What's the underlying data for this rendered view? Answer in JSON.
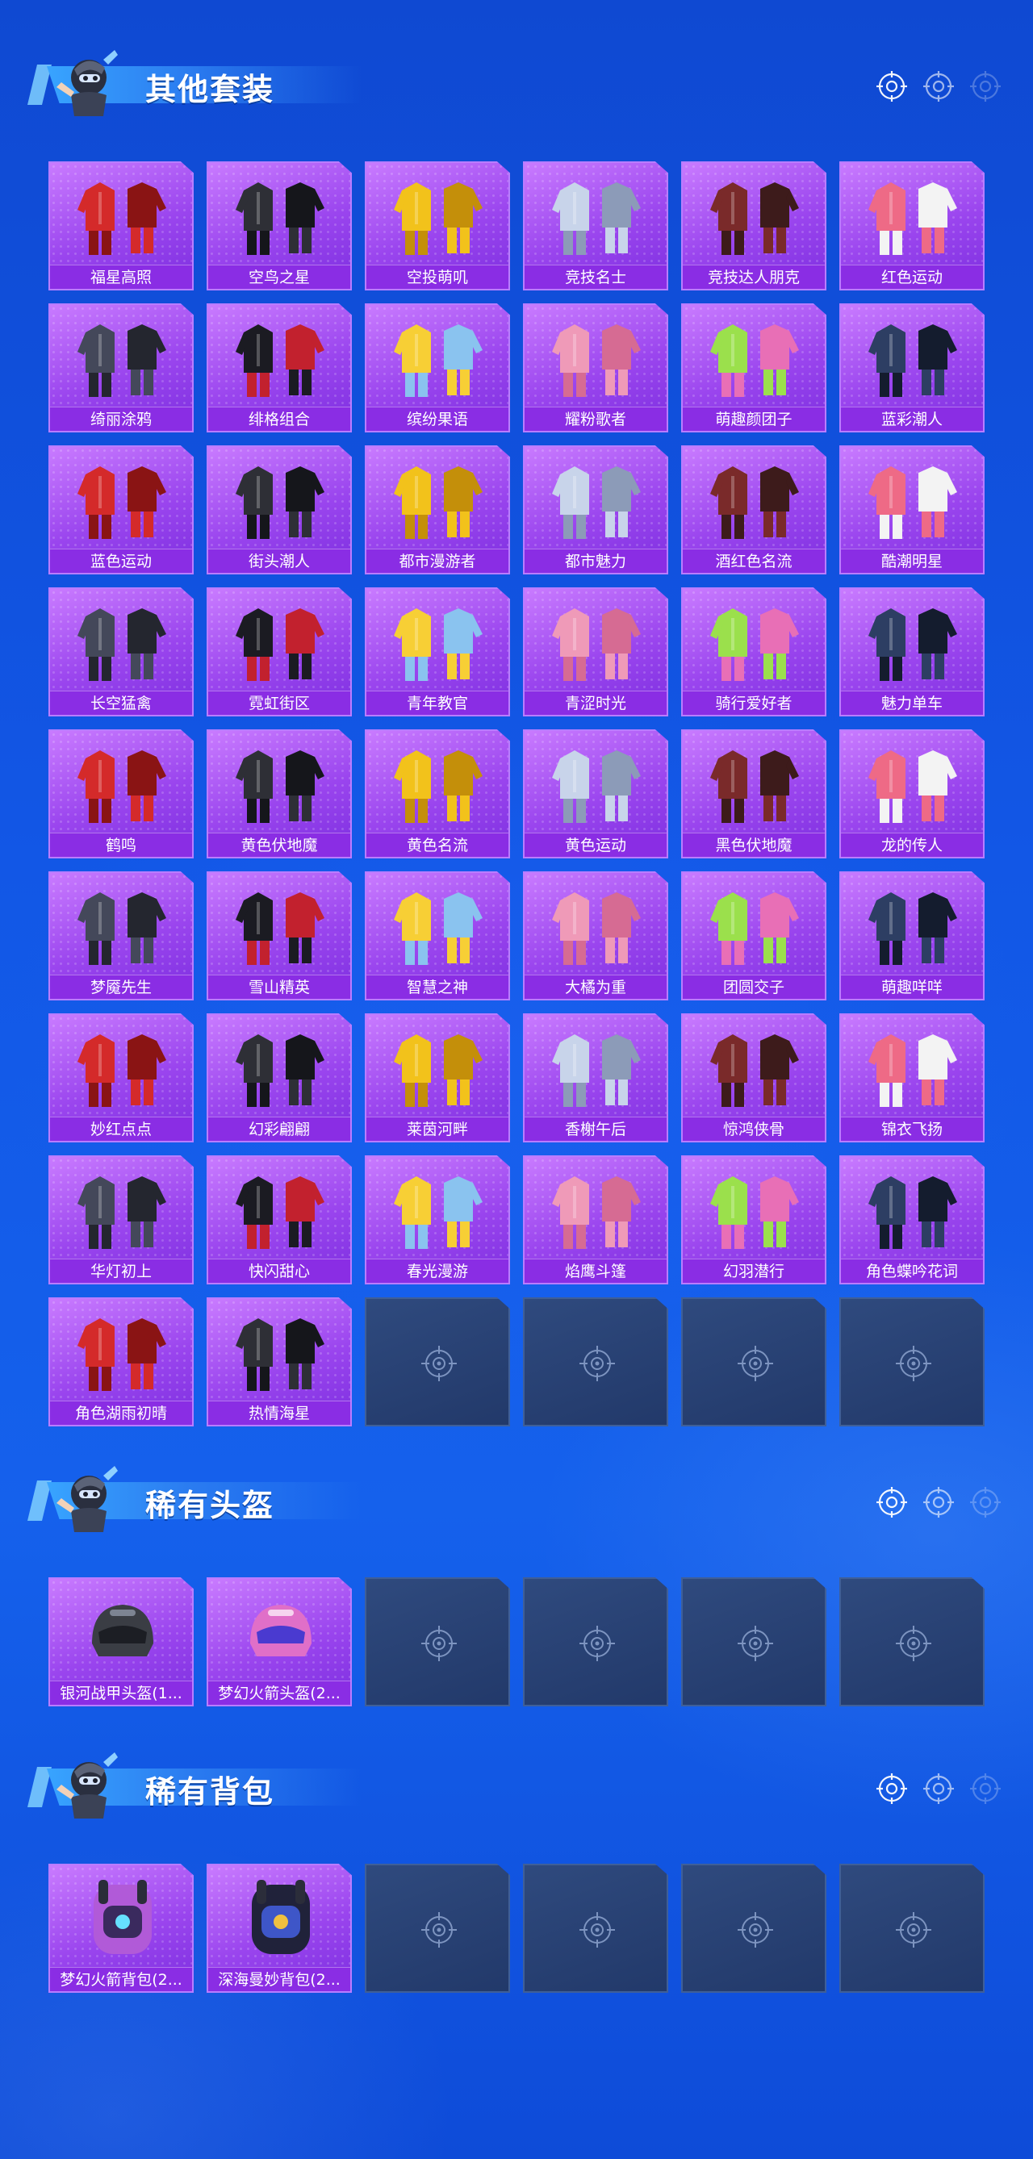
{
  "sections": [
    {
      "title": "其他套装",
      "items": [
        "福星高照",
        "空鸟之星",
        "空投萌叽",
        "竞技名士",
        "竞技达人朋克",
        "红色运动",
        "绮丽涂鸦",
        "绯格组合",
        "缤纷果语",
        "耀粉歌者",
        "萌趣颜团子",
        "蓝彩潮人",
        "蓝色运动",
        "街头潮人",
        "都市漫游者",
        "都市魅力",
        "酒红色名流",
        "酷潮明星",
        "长空猛禽",
        "霓虹街区",
        "青年教官",
        "青涩时光",
        "骑行爱好者",
        "魅力单车",
        "鹤鸣",
        "黄色伏地魔",
        "黄色名流",
        "黄色运动",
        "黑色伏地魔",
        "龙的传人",
        "梦魇先生",
        "雪山精英",
        "智慧之神",
        "大橘为重",
        "团圆交子",
        "萌趣咩咩",
        "妙红点点",
        "幻彩翩翩",
        "莱茵河畔",
        "香榭午后",
        "惊鸿侠骨",
        "锦衣飞扬",
        "华灯初上",
        "快闪甜心",
        "春光漫游",
        "焰鹰斗篷",
        "幻羽潜行",
        "角色蝶吟花词",
        "角色湖雨初晴",
        "热情海星"
      ],
      "empty_slots": 4
    },
    {
      "title": "稀有头盔",
      "items": [
        "银河战甲头盔(1...",
        "梦幻火箭头盔(2..."
      ],
      "empty_slots": 4
    },
    {
      "title": "稀有背包",
      "items": [
        "梦幻火箭背包(2...",
        "深海曼妙背包(2..."
      ],
      "empty_slots": 4
    }
  ],
  "colors": {
    "background": "#1257e6",
    "card_purple": "#9a45ee",
    "label_bar": "#8a2de4",
    "empty_slot": "#263f70"
  }
}
